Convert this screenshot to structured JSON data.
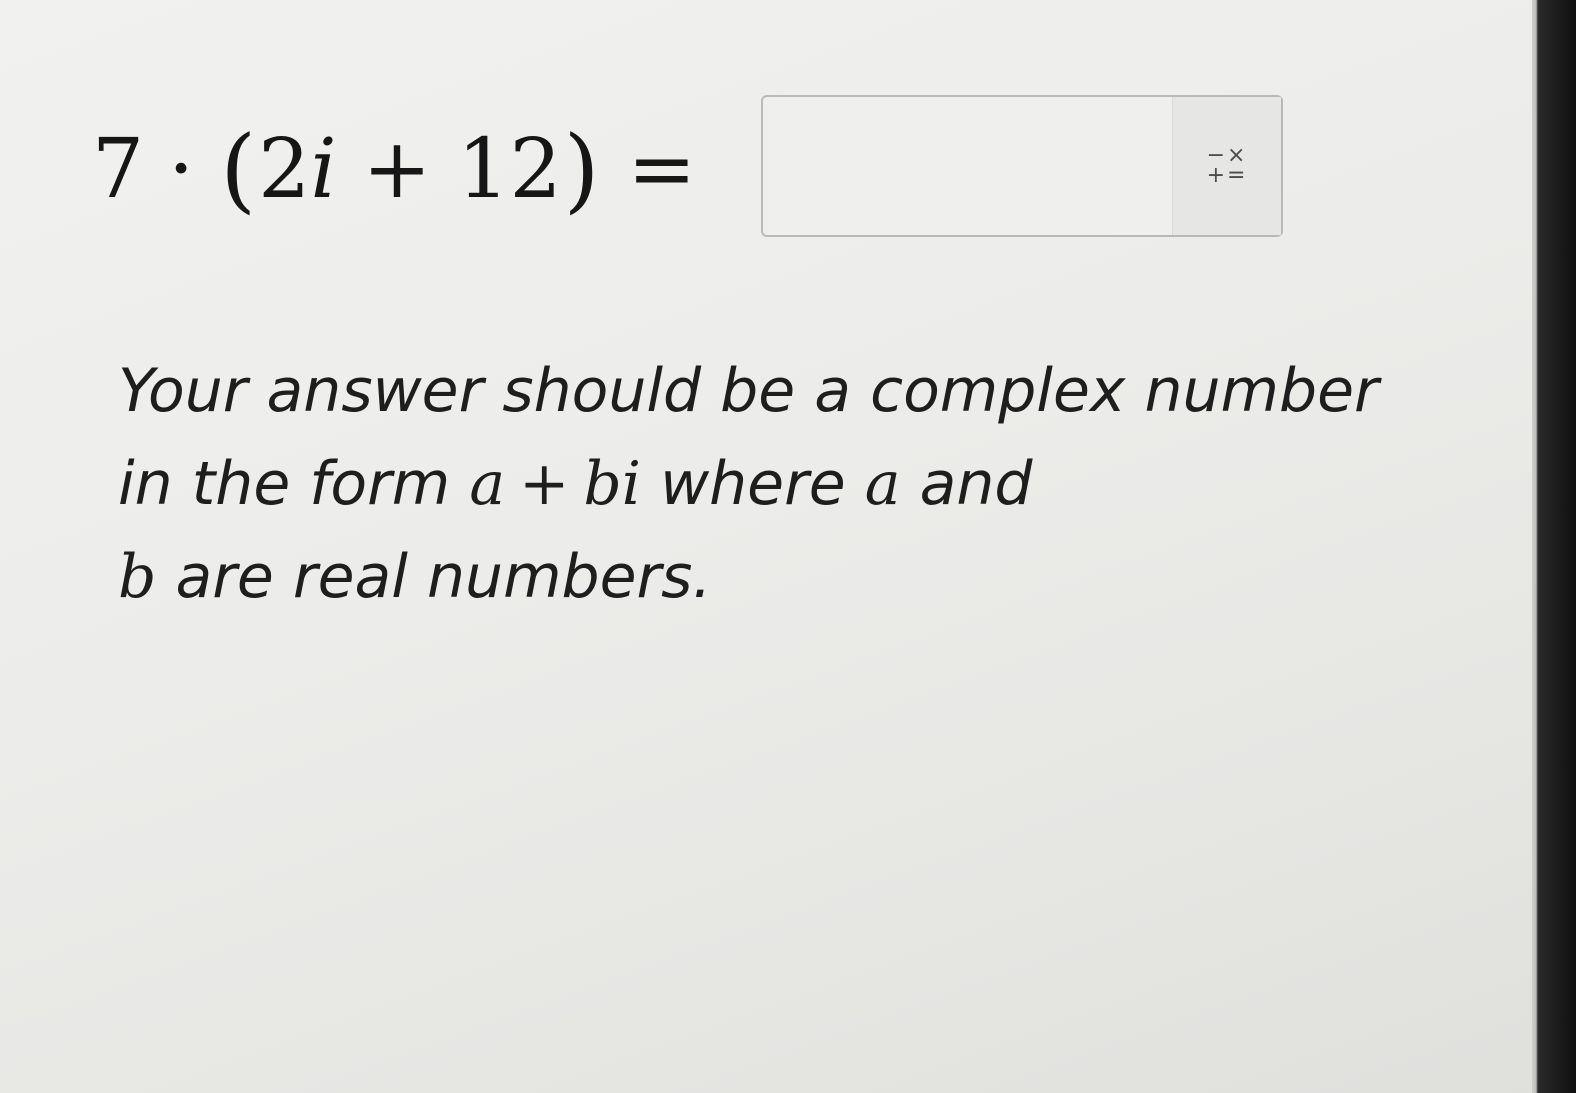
{
  "question": {
    "coefficient": "7",
    "dot": "·",
    "open_paren": "(",
    "term1_num": "2",
    "term1_var": "i",
    "plus": "+",
    "term2": "12",
    "close_paren": ")",
    "equals": "="
  },
  "answer": {
    "value": "",
    "placeholder": ""
  },
  "math_button": {
    "top_glyphs": "−×",
    "bottom_glyphs": "+="
  },
  "instructions": {
    "part1": "Your answer should be a complex number in the form ",
    "var_a": "a",
    "plus": "+",
    "var_bi": "bi",
    "part2": " where ",
    "var_a2": "a",
    "part3": " and ",
    "var_b": "b",
    "part4": " are real numbers."
  }
}
